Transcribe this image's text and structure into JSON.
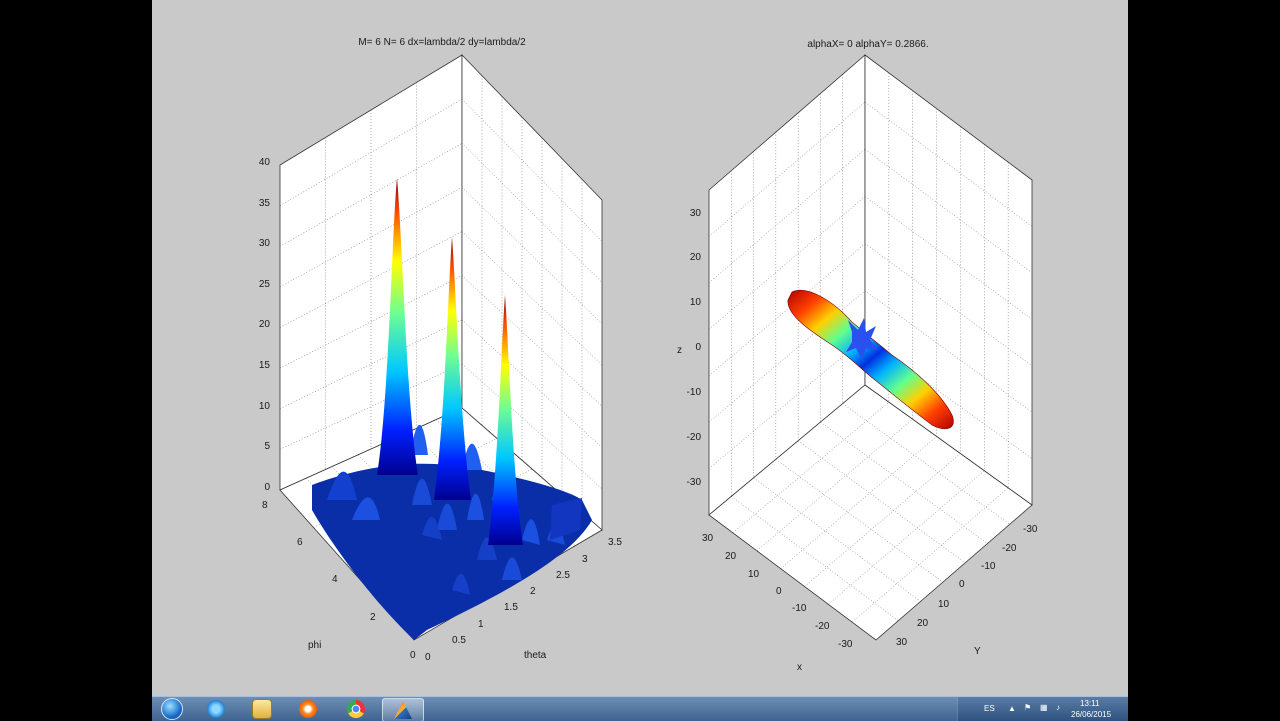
{
  "left_plot": {
    "title": "M= 6 N= 6 dx=lambda/2 dy=lambda/2",
    "z_ticks": [
      "0",
      "5",
      "10",
      "15",
      "20",
      "25",
      "30",
      "35",
      "40"
    ],
    "phi_ticks": [
      "0",
      "2",
      "4",
      "6",
      "8"
    ],
    "theta_ticks": [
      "0",
      "0.5",
      "1",
      "1.5",
      "2",
      "2.5",
      "3",
      "3.5"
    ],
    "xlabel": "theta",
    "ylabel": "phi"
  },
  "right_plot": {
    "title": "alphaX= 0 alphaY= 0.2866.",
    "z_ticks": [
      "30",
      "20",
      "10",
      "0",
      "-10",
      "-20",
      "-30"
    ],
    "x_ticks": [
      "30",
      "20",
      "10",
      "0",
      "-10",
      "-20",
      "-30"
    ],
    "y_ticks": [
      "-30",
      "-20",
      "-10",
      "0",
      "10",
      "20",
      "30"
    ],
    "xlabel": "x",
    "ylabel": "Y",
    "zlabel": "z"
  },
  "taskbar": {
    "language": "ES",
    "time": "13:11",
    "date": "26/06/2015",
    "icons": [
      "start-orb-icon",
      "ie-icon",
      "explorer-icon",
      "media-player-icon",
      "chrome-icon",
      "matlab-icon"
    ]
  },
  "chart_data": [
    {
      "type": "surface",
      "title": "M= 6 N= 6 dx=lambda/2 dy=lambda/2",
      "xlabel": "theta",
      "ylabel": "phi",
      "zlabel": "",
      "xlim": [
        0,
        3.5
      ],
      "ylim": [
        0,
        8
      ],
      "zlim": [
        0,
        40
      ],
      "colormap": "jet",
      "grid": true,
      "peaks": [
        {
          "theta": 0.5,
          "phi": 6.3,
          "z": 37
        },
        {
          "theta": 1.4,
          "phi": 4.8,
          "z": 31
        },
        {
          "theta": 2.5,
          "phi": 3.2,
          "z": 23
        }
      ]
    },
    {
      "type": "3d-radiation-pattern",
      "title": "alphaX= 0 alphaY= 0.2866.",
      "xlabel": "x",
      "ylabel": "Y",
      "zlabel": "z",
      "xlim": [
        -30,
        30
      ],
      "ylim": [
        -30,
        30
      ],
      "zlim": [
        -30,
        30
      ],
      "colormap": "jet",
      "grid": true
    }
  ]
}
